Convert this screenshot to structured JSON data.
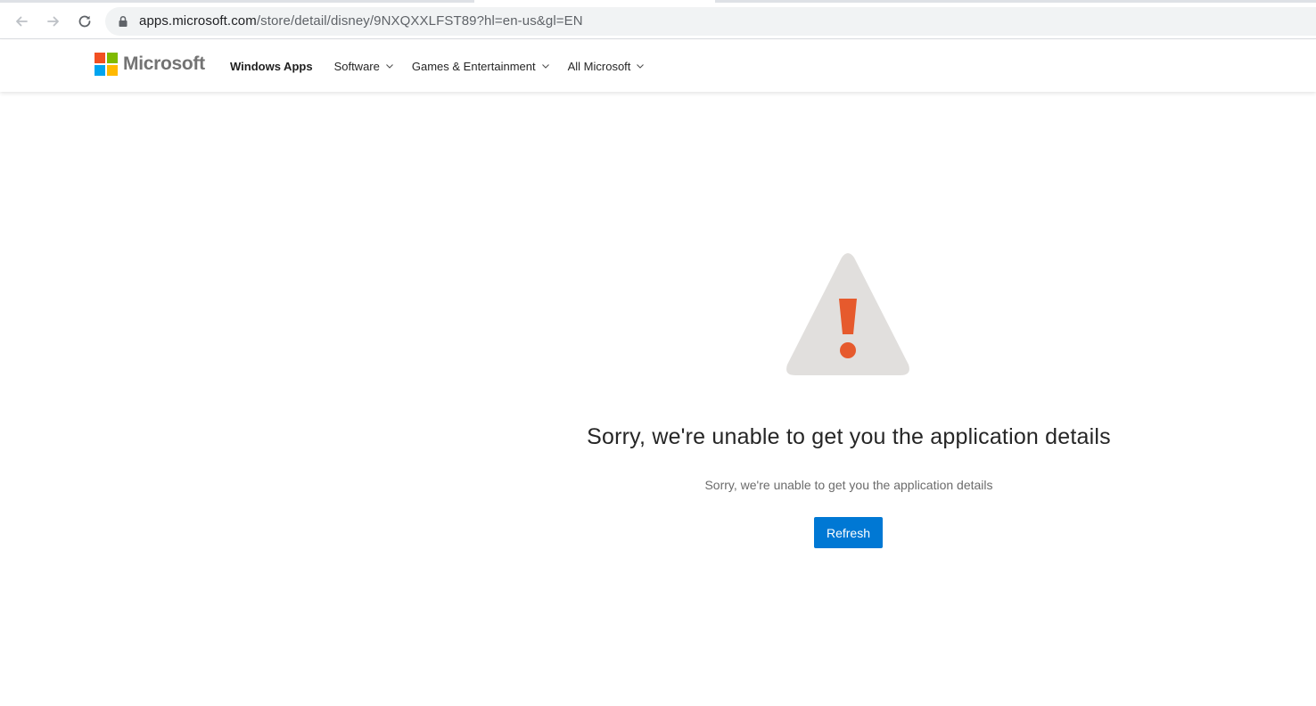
{
  "browser": {
    "url_host": "apps.microsoft.com",
    "url_path": "/store/detail/disney/9NXQXXLFST89?hl=en-us&gl=EN",
    "icons": [
      "back-arrow-icon",
      "forward-arrow-icon",
      "reload-icon",
      "lock-icon"
    ]
  },
  "header": {
    "brand": "Microsoft",
    "brand_colors": [
      "#f25022",
      "#7fba00",
      "#00a4ef",
      "#ffb900"
    ],
    "title": "Windows Apps",
    "nav": [
      {
        "label": "Software"
      },
      {
        "label": "Games & Entertainment"
      },
      {
        "label": "All Microsoft"
      }
    ]
  },
  "error": {
    "icon": "warning-triangle-icon",
    "icon_color": "#e1dfdd",
    "mark_color": "#e65a2d",
    "title": "Sorry, we're unable to get you the application details",
    "subtitle": "Sorry, we're unable to get you the application details",
    "button_label": "Refresh",
    "button_color": "#0078d4"
  }
}
